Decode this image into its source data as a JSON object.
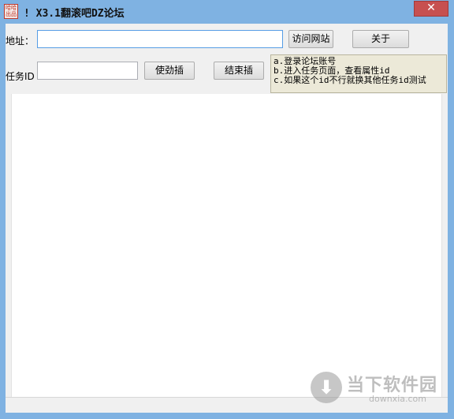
{
  "window": {
    "title": "! X3.1翻滚吧DZ论坛",
    "app_icon_text": "哈哈出品",
    "close_label": "✕"
  },
  "address": {
    "label": "地址：",
    "value": "",
    "visit_button": "访问网站",
    "about_button": "关于"
  },
  "task": {
    "label": "任务ID",
    "value": "",
    "start_button": "使劲插",
    "stop_button": "结束插"
  },
  "instructions": [
    "a.登录论坛账号",
    "b.进入任务页面，查看属性id",
    "c.如果这个id不行就换其他任务id测试"
  ],
  "watermark": {
    "brand": "当下软件园",
    "url": "downxia.com"
  },
  "colors": {
    "titlebar": "#7fb2e2",
    "close": "#c75050",
    "client_bg": "#f0f0f0",
    "tooltip_bg": "#ece9d8"
  }
}
